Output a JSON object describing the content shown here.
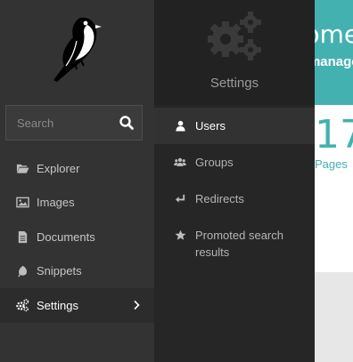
{
  "background_page": {
    "header_title": "Welcome",
    "header_subtitle": "Wagtail managers",
    "stat_number": "17",
    "stat_label": "Pages"
  },
  "sidebar": {
    "search_placeholder": "Search",
    "items": [
      {
        "label": "Explorer",
        "icon": "folder-open-icon"
      },
      {
        "label": "Images",
        "icon": "image-icon"
      },
      {
        "label": "Documents",
        "icon": "document-icon"
      },
      {
        "label": "Snippets",
        "icon": "snippet-icon"
      },
      {
        "label": "Settings",
        "icon": "cogs-icon",
        "active": true
      }
    ]
  },
  "submenu": {
    "title": "Settings",
    "items": [
      {
        "label": "Users",
        "icon": "user-icon",
        "active": true
      },
      {
        "label": "Groups",
        "icon": "group-icon"
      },
      {
        "label": "Redirects",
        "icon": "redirect-icon"
      },
      {
        "label": "Promoted search results",
        "icon": "star-icon"
      }
    ]
  },
  "colors": {
    "sidebar_bg": "#333333",
    "submenu_bg": "#262626",
    "accent_teal": "#43b1b0"
  }
}
